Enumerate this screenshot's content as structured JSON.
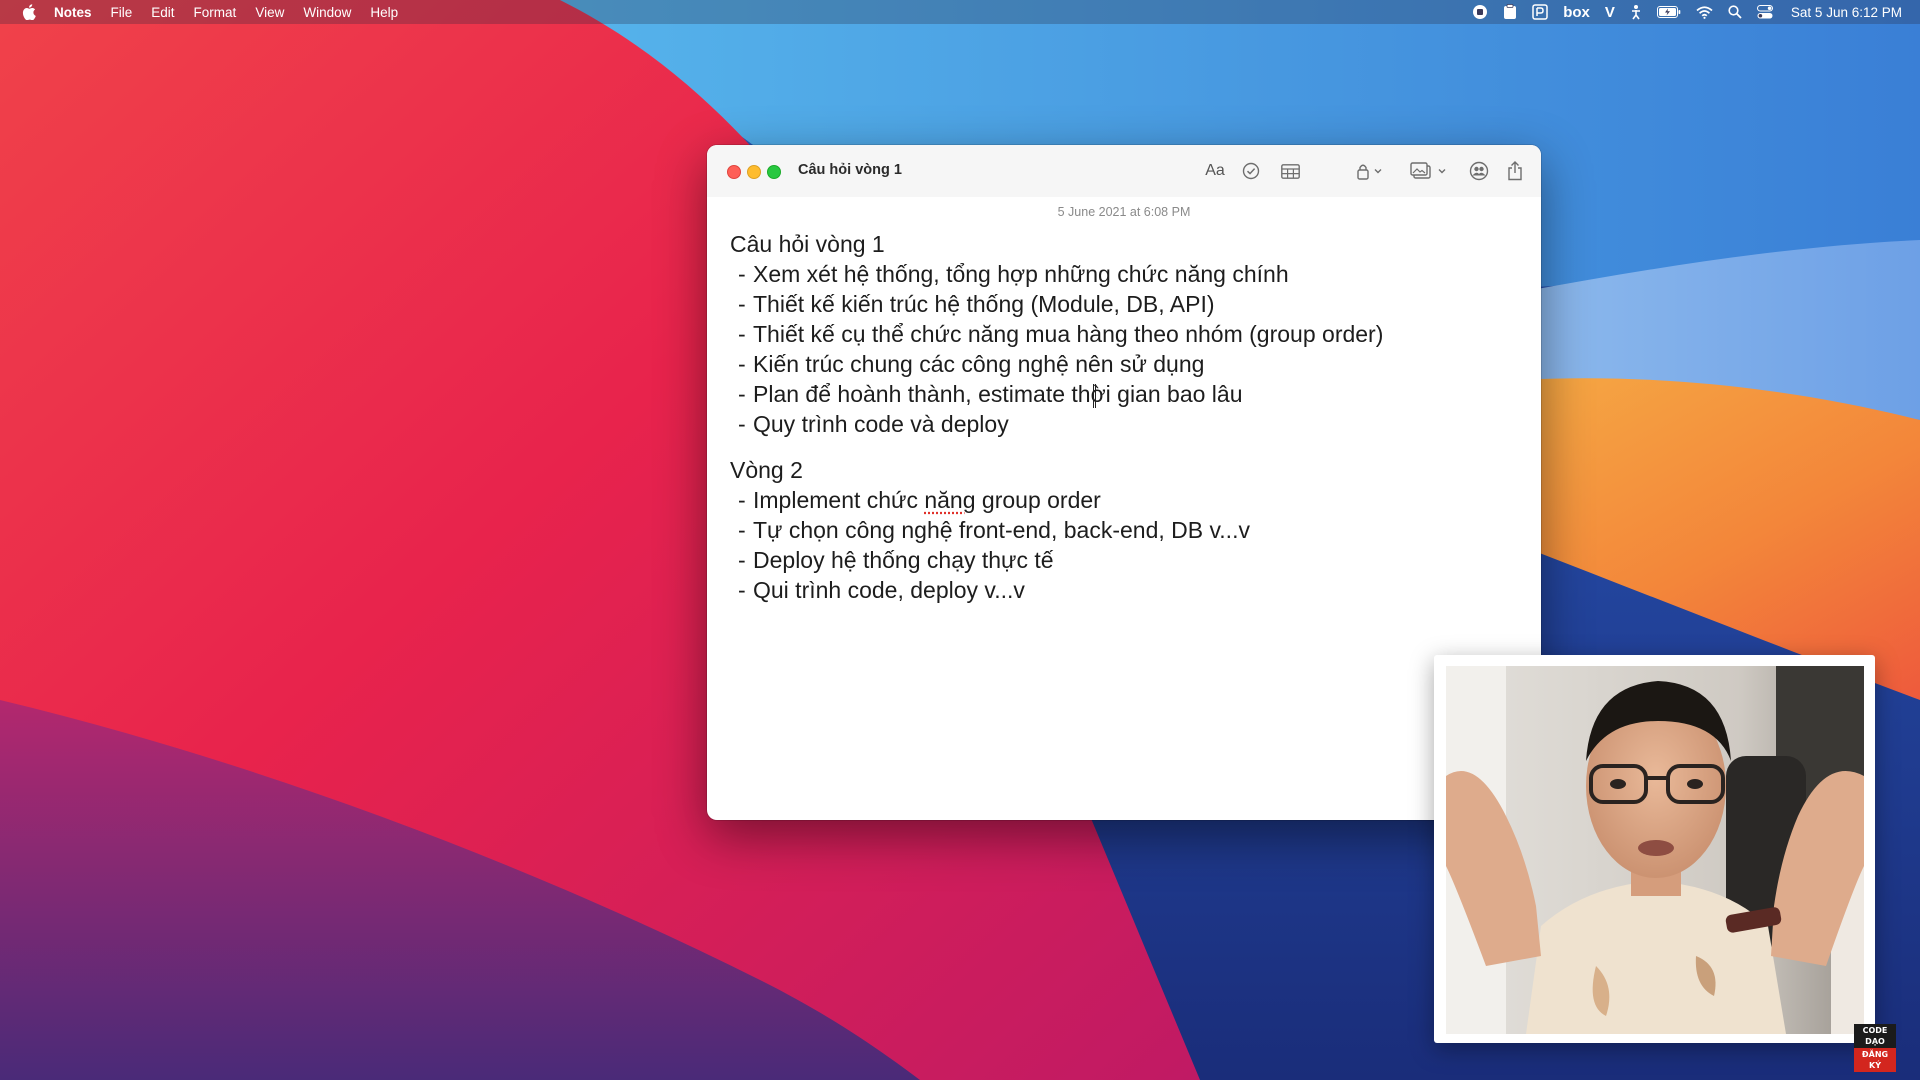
{
  "menubar": {
    "apple_icon": "apple-logo-icon",
    "app_name": "Notes",
    "items": [
      "File",
      "Edit",
      "Format",
      "View",
      "Window",
      "Help"
    ],
    "status_icons": [
      "screen-record-icon",
      "clipboard-icon",
      "parallels-icon",
      "box-icon",
      "v-icon",
      "accessibility-icon",
      "battery-charging-icon",
      "wifi-icon",
      "spotlight-search-icon",
      "control-center-icon"
    ],
    "box_label": "box",
    "v_label": "V",
    "clock": "Sat 5 Jun  6:12 PM"
  },
  "window": {
    "title": "Câu hỏi vòng 1",
    "toolbar": {
      "format_label": "Aa",
      "icons": [
        "checklist-icon",
        "table-icon",
        "lock-icon",
        "media-icon",
        "collaborate-icon",
        "share-icon"
      ]
    },
    "date": "5 June 2021 at 6:08 PM"
  },
  "note": {
    "round1_heading": "Câu hỏi vòng 1",
    "round1_items": [
      "Xem xét hệ thống, tổng hợp những chức năng chính",
      "Thiết kế kiến trúc hệ thống (Module, DB, API)",
      "Thiết kế cụ thể chức năng mua hàng theo nhóm (group order)",
      "Kiến trúc chung các công nghệ nên sử dụng",
      "Plan để hoành thành, estimate thời gian bao lâu",
      "Quy trình code và deploy"
    ],
    "round2_heading": "Vòng 2",
    "round2_item1_pre": "Implement chức ",
    "round2_item1_misspelled": "năng",
    "round2_item1_post": " group order",
    "round2_items": [
      "Tự chọn công nghệ front-end, back-end, DB v...v",
      "Deploy hệ thống chạy thực tế",
      "Qui trình code, deploy v...v"
    ],
    "dash": "-"
  },
  "webcam": {
    "watermark_top": "CODE DẠO",
    "watermark_bottom": "ĐĂNG KÝ"
  },
  "colors": {
    "traffic_close": "#fe5f57",
    "traffic_minimize": "#febc2e",
    "traffic_maximize": "#28c840",
    "spellcheck": "#e0312b"
  }
}
